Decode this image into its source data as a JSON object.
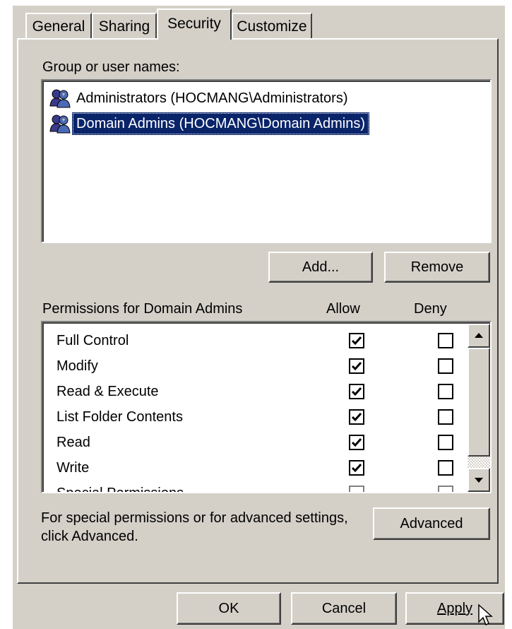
{
  "tabs": [
    {
      "label": "General",
      "active": false
    },
    {
      "label": "Sharing",
      "active": false
    },
    {
      "label": "Security",
      "active": true
    },
    {
      "label": "Customize",
      "active": false
    }
  ],
  "group_list": {
    "label": "Group or user names:",
    "items": [
      {
        "name": "Administrators (HOCMANG\\Administrators)",
        "selected": false
      },
      {
        "name": "Domain Admins (HOCMANG\\Domain Admins)",
        "selected": true
      }
    ]
  },
  "buttons": {
    "add": "Add...",
    "remove": "Remove",
    "advanced": "Advanced",
    "ok": "OK",
    "cancel": "Cancel",
    "apply": "Apply"
  },
  "permissions": {
    "label": "Permissions for Domain Admins",
    "allow_header": "Allow",
    "deny_header": "Deny",
    "rows": [
      {
        "name": "Full Control",
        "allow": true,
        "deny": false
      },
      {
        "name": "Modify",
        "allow": true,
        "deny": false
      },
      {
        "name": "Read & Execute",
        "allow": true,
        "deny": false
      },
      {
        "name": "List Folder Contents",
        "allow": true,
        "deny": false
      },
      {
        "name": "Read",
        "allow": true,
        "deny": false
      },
      {
        "name": "Write",
        "allow": true,
        "deny": false
      },
      {
        "name": "Special Permissions",
        "allow": false,
        "deny": false
      }
    ]
  },
  "advanced_note": {
    "line1": "For special permissions or for advanced settings,",
    "line2": "click Advanced."
  },
  "colors": {
    "dialog_bg": "#d4d0c8",
    "selection": "#0a246a",
    "shadow": "#404040"
  },
  "icons": {
    "user_group": "users-group-icon",
    "scroll_up": "arrow-up-icon",
    "scroll_down": "arrow-down-icon",
    "check": "check-icon",
    "cursor": "mouse-pointer-icon"
  }
}
